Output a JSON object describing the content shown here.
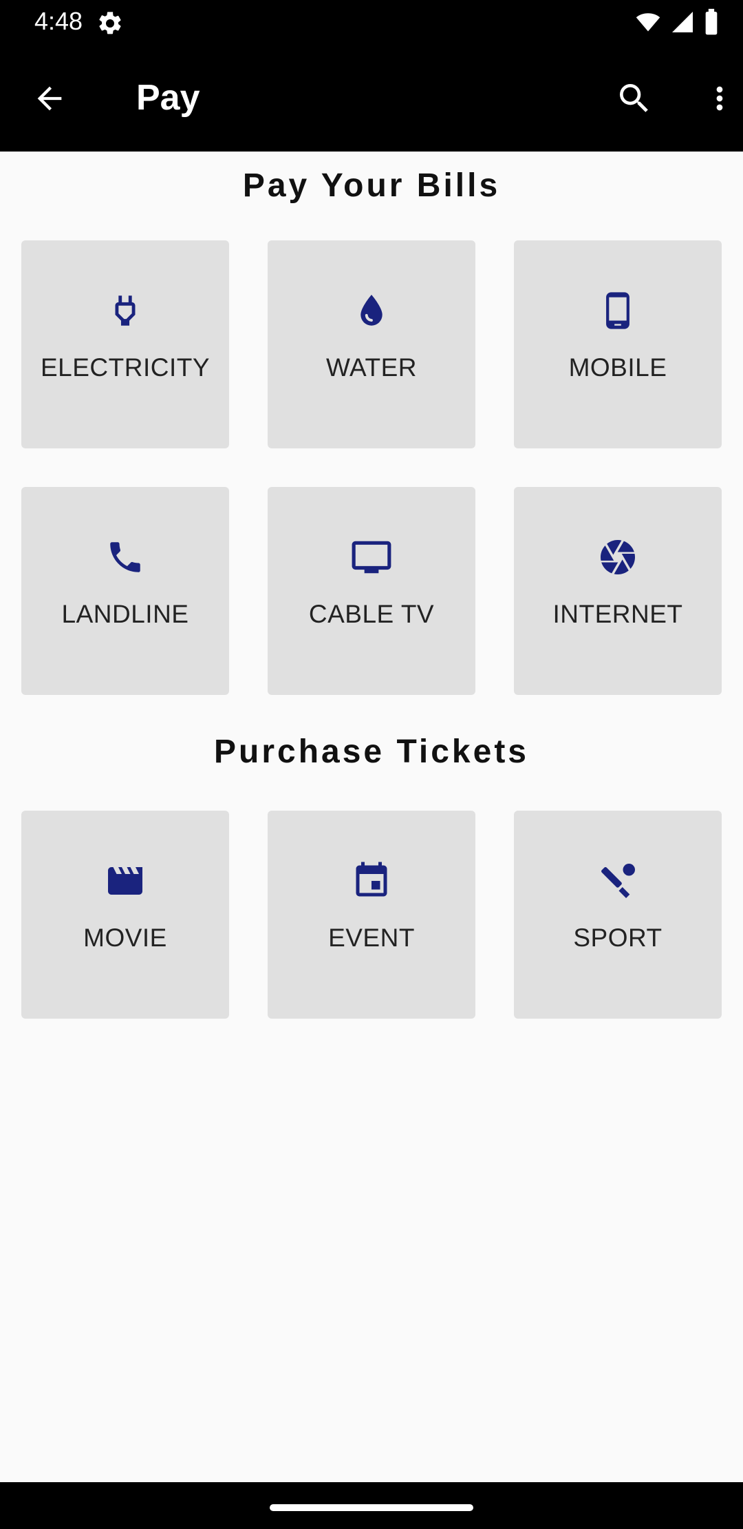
{
  "status_bar": {
    "time": "4:48",
    "icons": [
      "settings-gear-icon",
      "wifi-icon",
      "cellular-signal-icon",
      "battery-icon"
    ]
  },
  "app_bar": {
    "title": "Pay",
    "icons": [
      "back-arrow-icon",
      "search-icon",
      "more-vert-icon"
    ]
  },
  "colors": {
    "icon_accent": "#1a237e",
    "tile_bg": "#e0e0e0",
    "page_bg": "#fafafa"
  },
  "bills": {
    "title": "Pay Your Bills",
    "items": [
      {
        "label": "ELECTRICITY",
        "icon": "plug-icon"
      },
      {
        "label": "WATER",
        "icon": "water-drop-icon"
      },
      {
        "label": "MOBILE",
        "icon": "smartphone-icon"
      },
      {
        "label": "LANDLINE",
        "icon": "phone-icon"
      },
      {
        "label": "CABLE TV",
        "icon": "tv-icon"
      },
      {
        "label": "INTERNET",
        "icon": "camera-aperture-icon"
      }
    ]
  },
  "tickets": {
    "title": "Purchase Tickets",
    "items": [
      {
        "label": "MOVIE",
        "icon": "movie-clapper-icon"
      },
      {
        "label": "EVENT",
        "icon": "event-calendar-icon"
      },
      {
        "label": "SPORT",
        "icon": "cricket-icon"
      }
    ]
  }
}
